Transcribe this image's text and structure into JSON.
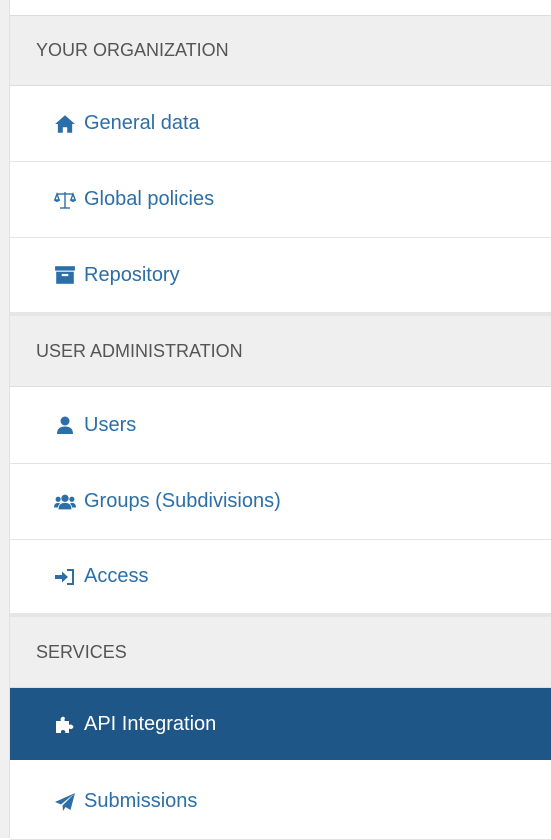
{
  "sidebar": {
    "sections": [
      {
        "header": "YOUR ORGANIZATION",
        "items": [
          {
            "label": "General data",
            "icon": "home-icon"
          },
          {
            "label": "Global policies",
            "icon": "balance-scale-icon"
          },
          {
            "label": "Repository",
            "icon": "archive-icon"
          }
        ]
      },
      {
        "header": "USER ADMINISTRATION",
        "items": [
          {
            "label": "Users",
            "icon": "user-icon"
          },
          {
            "label": "Groups (Subdivisions)",
            "icon": "users-icon"
          },
          {
            "label": "Access",
            "icon": "sign-in-icon"
          }
        ]
      },
      {
        "header": "SERVICES",
        "items": [
          {
            "label": "API Integration",
            "icon": "puzzle-icon",
            "active": true
          },
          {
            "label": "Submissions",
            "icon": "paper-plane-icon"
          }
        ]
      }
    ]
  },
  "colors": {
    "link": "#2c6fa8",
    "active_bg": "#1e5687",
    "active_text": "#ffffff",
    "header_bg": "#efefef",
    "header_text": "#555555"
  }
}
